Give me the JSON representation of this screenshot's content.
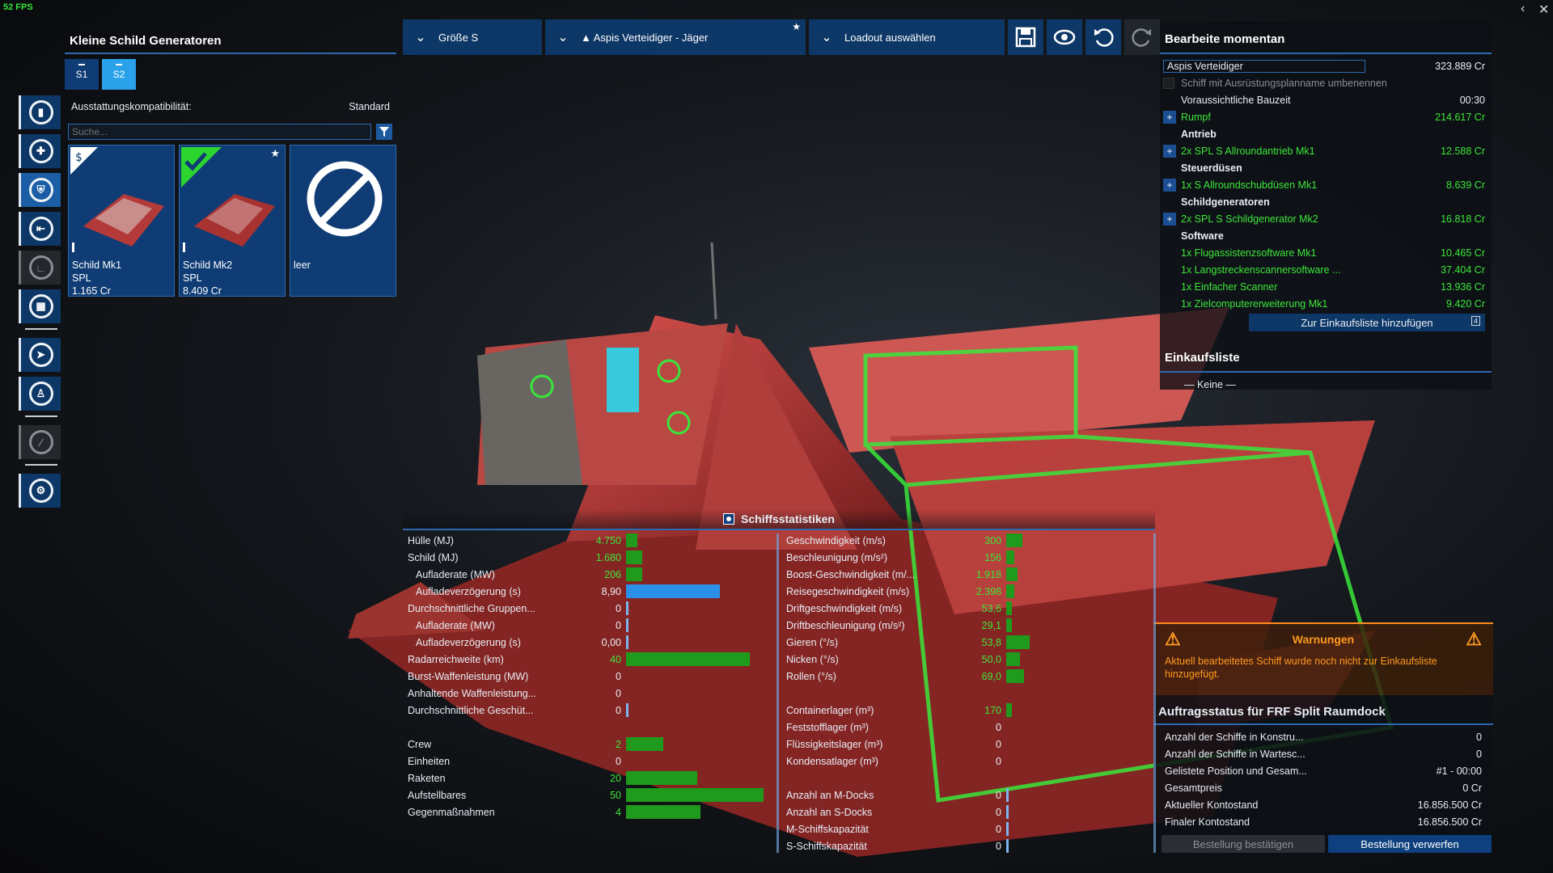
{
  "fps": "52 FPS",
  "left_panel": {
    "title": "Kleine Schild Generatoren",
    "tabs": [
      "S1",
      "S2"
    ],
    "active_tab": "S2",
    "compat_label": "Ausstattungskompatibilität:",
    "compat_value": "Standard",
    "search_placeholder": "Suche...",
    "search_count": "0",
    "cards": [
      {
        "name": "Schild Mk1",
        "maker": "SPL",
        "price": "1.165 Cr"
      },
      {
        "name": "Schild Mk2",
        "maker": "SPL",
        "price": "8.409 Cr"
      },
      {
        "name": "leer"
      }
    ]
  },
  "topbar": {
    "size": "Größe S",
    "ship": "▲ Aspis Verteidiger - Jäger",
    "loadout": "Loadout auswählen"
  },
  "right_panel": {
    "title": "Bearbeite momentan",
    "ship_name": "Aspis Verteidiger",
    "ship_price": "323.889 Cr",
    "rename_label": "Schiff mit Ausrüstungsplanname umbenennen",
    "build_time_label": "Voraussichtliche Bauzeit",
    "build_time": "00:30",
    "items": [
      {
        "type": "item",
        "plus": true,
        "label": "Rumpf",
        "value": "214.617 Cr"
      },
      {
        "type": "section",
        "label": "Antrieb"
      },
      {
        "type": "item",
        "plus": true,
        "label": "2x SPL S Allroundantrieb Mk1",
        "value": "12.588 Cr"
      },
      {
        "type": "section",
        "label": "Steuerdüsen"
      },
      {
        "type": "item",
        "plus": true,
        "label": "1x S Allroundschubdüsen Mk1",
        "value": "8.639 Cr"
      },
      {
        "type": "section",
        "label": "Schildgeneratoren"
      },
      {
        "type": "item",
        "plus": true,
        "label": "2x SPL S Schildgenerator Mk2",
        "value": "16.818 Cr"
      },
      {
        "type": "section",
        "label": "Software"
      },
      {
        "type": "item",
        "plus": false,
        "label": "1x Flugassistenzsoftware Mk1",
        "value": "10.465 Cr"
      },
      {
        "type": "item",
        "plus": false,
        "label": "1x Langstreckenscannersoftware ...",
        "value": "37.404 Cr"
      },
      {
        "type": "item",
        "plus": false,
        "label": "1x Einfacher Scanner",
        "value": "13.936 Cr"
      },
      {
        "type": "item",
        "plus": false,
        "label": "1x Zielcomputererweiterung Mk1",
        "value": "9.420 Cr"
      }
    ],
    "add_button": "Zur Einkaufsliste hinzufügen",
    "add_count": "4",
    "shopping_title": "Einkaufsliste",
    "shopping_empty": "— Keine —"
  },
  "warnings": {
    "title": "Warnungen",
    "text": "Aktuell bearbeitetes Schiff wurde noch nicht zur Einkaufsliste hinzugefügt."
  },
  "order": {
    "title": "Auftragsstatus für FRF Split Raumdock",
    "rows": [
      {
        "label": "Anzahl der Schiffe in Konstru...",
        "value": "0"
      },
      {
        "label": "Anzahl der Schiffe in Wartesc...",
        "value": "0"
      },
      {
        "label": "Gelistete Position und Gesam...",
        "value": "#1 - 00:00"
      },
      {
        "label": "Gesamtpreis",
        "value": "0 Cr"
      },
      {
        "label": "Aktueller Kontostand",
        "value": "16.856.500 Cr"
      },
      {
        "label": "Finaler Kontostand",
        "value": "16.856.500 Cr"
      }
    ],
    "confirm": "Bestellung bestätigen",
    "discard": "Bestellung verwerfen"
  },
  "stats": {
    "title": "Schiffsstatistiken",
    "col1": [
      {
        "label": "Hülle (MJ)",
        "value": "4.750",
        "green": true,
        "bar": 0.08
      },
      {
        "label": "Schild (MJ)",
        "value": "1.680",
        "green": true,
        "bar": 0.12
      },
      {
        "label": "Aufladerate (MW)",
        "value": "206",
        "green": true,
        "sub": true,
        "bar": 0.12
      },
      {
        "label": "Aufladeverzögerung (s)",
        "value": "8,90",
        "sub": true,
        "bar": 0.68,
        "blue": true
      },
      {
        "label": "Durchschnittliche Gruppen...",
        "value": "0",
        "bar": 0
      },
      {
        "label": "Aufladerate (MW)",
        "value": "0",
        "sub": true,
        "bar": 0
      },
      {
        "label": "Aufladeverzögerung (s)",
        "value": "0,00",
        "sub": true,
        "bar": 0
      },
      {
        "label": "Radarreichweite (km)",
        "value": "40",
        "green": true,
        "bar": 0.9
      },
      {
        "label": "Burst-Waffenleistung (MW)",
        "value": "0",
        "bar": null
      },
      {
        "label": "Anhaltende Waffenleistung...",
        "value": "0",
        "bar": null
      },
      {
        "label": "Durchschnittliche Geschüt...",
        "value": "0",
        "bar": 0
      },
      {
        "label": "",
        "value": "",
        "bar": null
      },
      {
        "label": "Crew",
        "value": "2",
        "green": true,
        "bar": 0.27
      },
      {
        "label": "Einheiten",
        "value": "0",
        "bar": null
      },
      {
        "label": "Raketen",
        "value": "20",
        "green": true,
        "bar": 0.52
      },
      {
        "label": "Aufstellbares",
        "value": "50",
        "green": true,
        "bar": 1.0
      },
      {
        "label": "Gegenmaßnahmen",
        "value": "4",
        "green": true,
        "bar": 0.54
      }
    ],
    "col2": [
      {
        "label": "Geschwindigkeit (m/s)",
        "value": "300",
        "green": true,
        "bar": 0.12
      },
      {
        "label": "Beschleunigung (m/s²)",
        "value": "156",
        "green": true,
        "bar": 0.06
      },
      {
        "label": "Boost-Geschwindigkeit (m/...",
        "value": "1.918",
        "green": true,
        "bar": 0.08
      },
      {
        "label": "Reisegeschwindigkeit (m/s)",
        "value": "2.398",
        "green": true,
        "bar": 0.06
      },
      {
        "label": "Driftgeschwindigkeit (m/s)",
        "value": "53,6",
        "green": true,
        "bar": 0.04
      },
      {
        "label": "Driftbeschleunigung (m/s²)",
        "value": "29,1",
        "green": true,
        "bar": 0.04
      },
      {
        "label": "Gieren (°/s)",
        "value": "53,8",
        "green": true,
        "bar": 0.17
      },
      {
        "label": "Nicken (°/s)",
        "value": "50,0",
        "green": true,
        "bar": 0.1
      },
      {
        "label": "Rollen (°/s)",
        "value": "69,0",
        "green": true,
        "bar": 0.13
      },
      {
        "label": "",
        "value": "",
        "bar": null
      },
      {
        "label": "Containerlager (m³)",
        "value": "170",
        "green": true,
        "bar": 0.04
      },
      {
        "label": "Feststofflager (m³)",
        "value": "0",
        "bar": null
      },
      {
        "label": "Flüssigkeitslager (m³)",
        "value": "0",
        "bar": null
      },
      {
        "label": "Kondensatlager (m³)",
        "value": "0",
        "bar": null
      },
      {
        "label": "",
        "value": "",
        "bar": null
      },
      {
        "label": "Anzahl an M-Docks",
        "value": "0",
        "bar": 0
      },
      {
        "label": "Anzahl an S-Docks",
        "value": "0",
        "bar": 0
      },
      {
        "label": "M-Schiffskapazität",
        "value": "0",
        "bar": 0
      },
      {
        "label": "S-Schiffskapazität",
        "value": "0",
        "bar": 0
      }
    ]
  },
  "colors": {
    "accent": "#2d6ab0",
    "panel": "#0d3766",
    "green": "#3ee63a",
    "warning": "#ff9a20"
  }
}
